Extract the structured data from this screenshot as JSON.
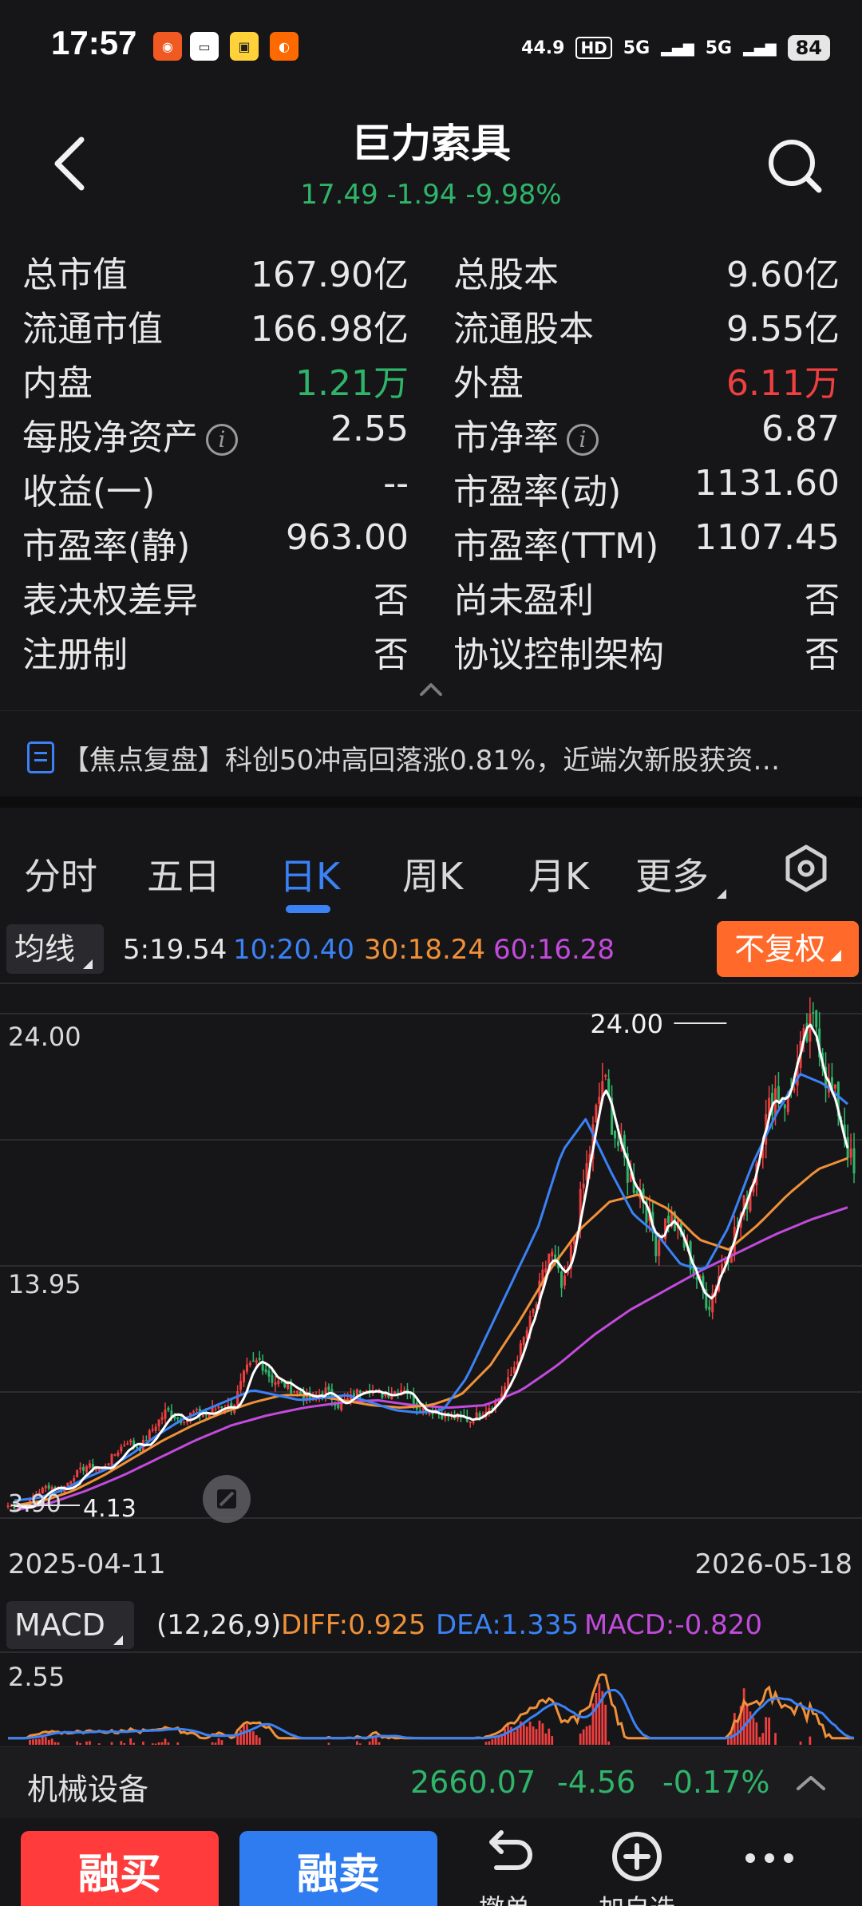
{
  "status_bar": {
    "time": "17:57",
    "net_speed": "44.9",
    "signal_labels": [
      "HD",
      "5G",
      "5G"
    ],
    "battery": "84",
    "app_icons": [
      "telecom-app-icon",
      "wallet-app-icon",
      "tuan-app-icon",
      "taobao-app-icon"
    ]
  },
  "header": {
    "back_icon": "chevron-left-icon",
    "title": "巨力索具",
    "price_change": "17.49 -1.94 -9.98%",
    "search_icon": "search-icon"
  },
  "stats": [
    {
      "label": "总市值",
      "value": "167.90亿",
      "label2": "总股本",
      "value2": "9.60亿"
    },
    {
      "label": "流通市值",
      "value": "166.98亿",
      "label2": "流通股本",
      "value2": "9.55亿"
    },
    {
      "label": "内盘",
      "value": "1.21万",
      "label2": "外盘",
      "value2": "6.11万"
    },
    {
      "label": "每股净资产",
      "value": "2.55",
      "label2": "市净率",
      "value2": "6.87"
    },
    {
      "label": "收益(一)",
      "value": "--",
      "label2": "市盈率(动)",
      "value2": "1131.60"
    },
    {
      "label": "市盈率(静)",
      "value": "963.00",
      "label2": "市盈率(TTM)",
      "value2": "1107.45"
    },
    {
      "label": "表决权差异",
      "value": "否",
      "label2": "尚未盈利",
      "value2": "否"
    },
    {
      "label": "注册制",
      "value": "否",
      "label2": "协议控制架构",
      "value2": "否"
    }
  ],
  "colors": {
    "up": "#ef3f3f",
    "down": "#2fb56a",
    "accent": "#3b82f6",
    "ma5": "#ffffff",
    "ma10": "#3b82f6",
    "ma30": "#f0913a",
    "ma60": "#c24bdc"
  },
  "news": {
    "icon": "document-icon",
    "text": "【焦点复盘】科创50冲高回落涨0.81%，近端次新股获资…"
  },
  "tabs": [
    {
      "label": "分时"
    },
    {
      "label": "五日"
    },
    {
      "label": "日K",
      "active": true
    },
    {
      "label": "周K"
    },
    {
      "label": "月K"
    },
    {
      "label": "更多"
    }
  ],
  "settings_icon": "hexagon-settings-icon",
  "ma_row": {
    "selector": "均线",
    "ma5": "5:19.54",
    "ma10": "10:20.40",
    "ma30": "30:18.24",
    "ma60": "60:16.28",
    "adjust": "不复权"
  },
  "chart_data": {
    "type": "candlestick",
    "y_labels": [
      "24.00",
      "13.95",
      "3.90"
    ],
    "ylim": [
      3.9,
      24.0
    ],
    "max_marker": "24.00",
    "min_marker": "4.13",
    "x_start": "2025-04-11",
    "x_end": "2026-05-18",
    "close_path": [
      4.4,
      4.3,
      4.8,
      5.2,
      5.0,
      5.6,
      6.0,
      5.8,
      6.4,
      7.0,
      6.7,
      7.5,
      8.2,
      7.8,
      8.1,
      8.0,
      8.4,
      8.3,
      9.8,
      10.2,
      9.4,
      9.2,
      8.9,
      8.6,
      9.0,
      8.4,
      8.7,
      9.2,
      8.8,
      8.9,
      9.1,
      8.3,
      8.2,
      8.0,
      7.9,
      7.8,
      8.2,
      8.6,
      9.5,
      11.0,
      12.5,
      14.6,
      12.8,
      15.6,
      18.5,
      21.5,
      19.0,
      17.5,
      16.8,
      14.8,
      16.0,
      15.0,
      13.6,
      12.4,
      14.0,
      15.3,
      16.8,
      19.0,
      21.0,
      20.5,
      22.4,
      24.0,
      21.2,
      20.0,
      17.49
    ],
    "ma10_path": [
      4.6,
      4.7,
      5.0,
      5.5,
      5.9,
      6.5,
      7.2,
      7.8,
      8.2,
      8.6,
      9.0,
      8.8,
      8.6,
      8.7,
      8.8,
      8.5,
      8.2,
      8.1,
      8.2,
      9.5,
      11.5,
      13.5,
      15.5,
      18.5,
      19.8,
      17.8,
      16.0,
      15.2,
      14.0,
      13.8,
      15.5,
      18.0,
      20.0,
      21.6,
      21.2,
      20.4
    ],
    "ma30_path": [
      4.4,
      4.6,
      5.0,
      5.6,
      6.3,
      7.0,
      7.6,
      8.1,
      8.5,
      8.8,
      8.8,
      8.6,
      8.4,
      8.3,
      8.4,
      8.8,
      10.0,
      11.8,
      13.8,
      15.4,
      16.5,
      16.8,
      16.2,
      15.0,
      14.6,
      15.6,
      16.8,
      17.8,
      18.24
    ],
    "ma60_path": [
      4.2,
      4.5,
      5.0,
      5.6,
      6.3,
      7.0,
      7.6,
      8.0,
      8.3,
      8.5,
      8.6,
      8.4,
      8.3,
      8.4,
      9.0,
      10.0,
      11.2,
      12.2,
      13.0,
      13.8,
      14.5,
      15.2,
      15.8,
      16.28
    ]
  },
  "zoom_icon": "expand-diagonal-icon",
  "macd_row": {
    "selector": "MACD",
    "params": "(12,26,9)",
    "diff": "DIFF:0.925",
    "dea": "DEA:1.335",
    "macd": "MACD:-0.820",
    "y_label": "2.55"
  },
  "sector": {
    "name": "机械设备",
    "value": "2660.07",
    "change": "-4.56",
    "pct": "-0.17%"
  },
  "bottom_bar": {
    "buy": "融买",
    "sell": "融卖",
    "cancel": "撤单",
    "add": "加自选",
    "more_icon": "more-dots-icon"
  }
}
